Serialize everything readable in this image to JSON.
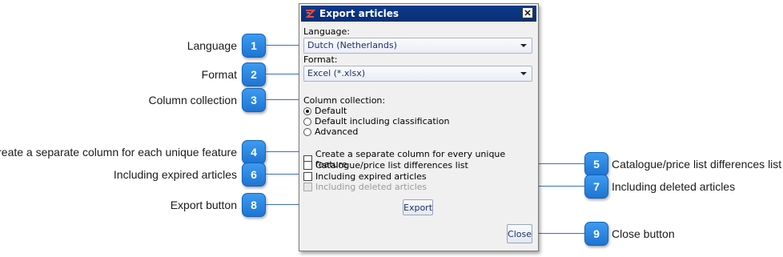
{
  "dialog": {
    "title": "Export articles",
    "language_label": "Language:",
    "language_value": "Dutch (Netherlands)",
    "format_label": "Format:",
    "format_value": "Excel (*.xlsx)",
    "column_collection_label": "Column collection:",
    "column_options": [
      {
        "label": "Default",
        "selected": true
      },
      {
        "label": "Default including classification",
        "selected": false
      },
      {
        "label": "Advanced",
        "selected": false
      }
    ],
    "checkboxes": [
      {
        "label": "Create a separate column for every unique feature",
        "checked": false,
        "enabled": true
      },
      {
        "label": "Catalogue/price list differences list",
        "checked": false,
        "enabled": true
      },
      {
        "label": "Including expired articles",
        "checked": false,
        "enabled": true
      },
      {
        "label": "Including deleted articles",
        "checked": false,
        "enabled": false
      }
    ],
    "export_button": "Export",
    "close_button": "Close"
  },
  "callouts": [
    {
      "number": "1",
      "label": "Language"
    },
    {
      "number": "2",
      "label": "Format"
    },
    {
      "number": "3",
      "label": "Column collection"
    },
    {
      "number": "4",
      "label": "Create a separate column for each unique feature"
    },
    {
      "number": "5",
      "label": "Catalogue/price list differences list"
    },
    {
      "number": "6",
      "label": "Including expired articles"
    },
    {
      "number": "7",
      "label": "Including deleted articles"
    },
    {
      "number": "8",
      "label": "Export button"
    },
    {
      "number": "9",
      "label": "Close button"
    }
  ],
  "colors": {
    "accent": "#1e74d2",
    "titlebar": "#0a2f73",
    "connector": "#3a6fc4"
  }
}
